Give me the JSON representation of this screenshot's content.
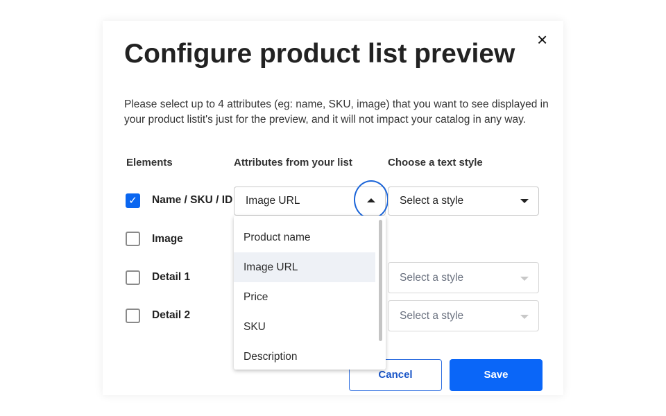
{
  "dialog": {
    "title": "Configure product list preview",
    "close_icon": "×",
    "description": "Please select up to 4 attributes (eg: name, SKU, image) that you want to see displayed in your product listit's just for the preview, and it will not impact your catalog in any way.",
    "headers": {
      "elements": "Elements",
      "attributes": "Attributes from your list",
      "style": "Choose a text style"
    },
    "rows": [
      {
        "label": "Name / SKU / ID",
        "checked": true,
        "attribute": "Image URL",
        "style": "Select a style"
      },
      {
        "label": "Image",
        "checked": false
      },
      {
        "label": "Detail 1",
        "checked": false,
        "style": "Select a style"
      },
      {
        "label": "Detail 2",
        "checked": false,
        "style": "Select a style"
      }
    ],
    "dropdown_options": [
      "Product name",
      "Image URL",
      "Price",
      "SKU",
      "Description"
    ],
    "dropdown_highlighted": "Image URL",
    "check_icon": "✓",
    "cancel_label": "Cancel",
    "save_label": "Save",
    "accent_color": "#0a66f8"
  }
}
